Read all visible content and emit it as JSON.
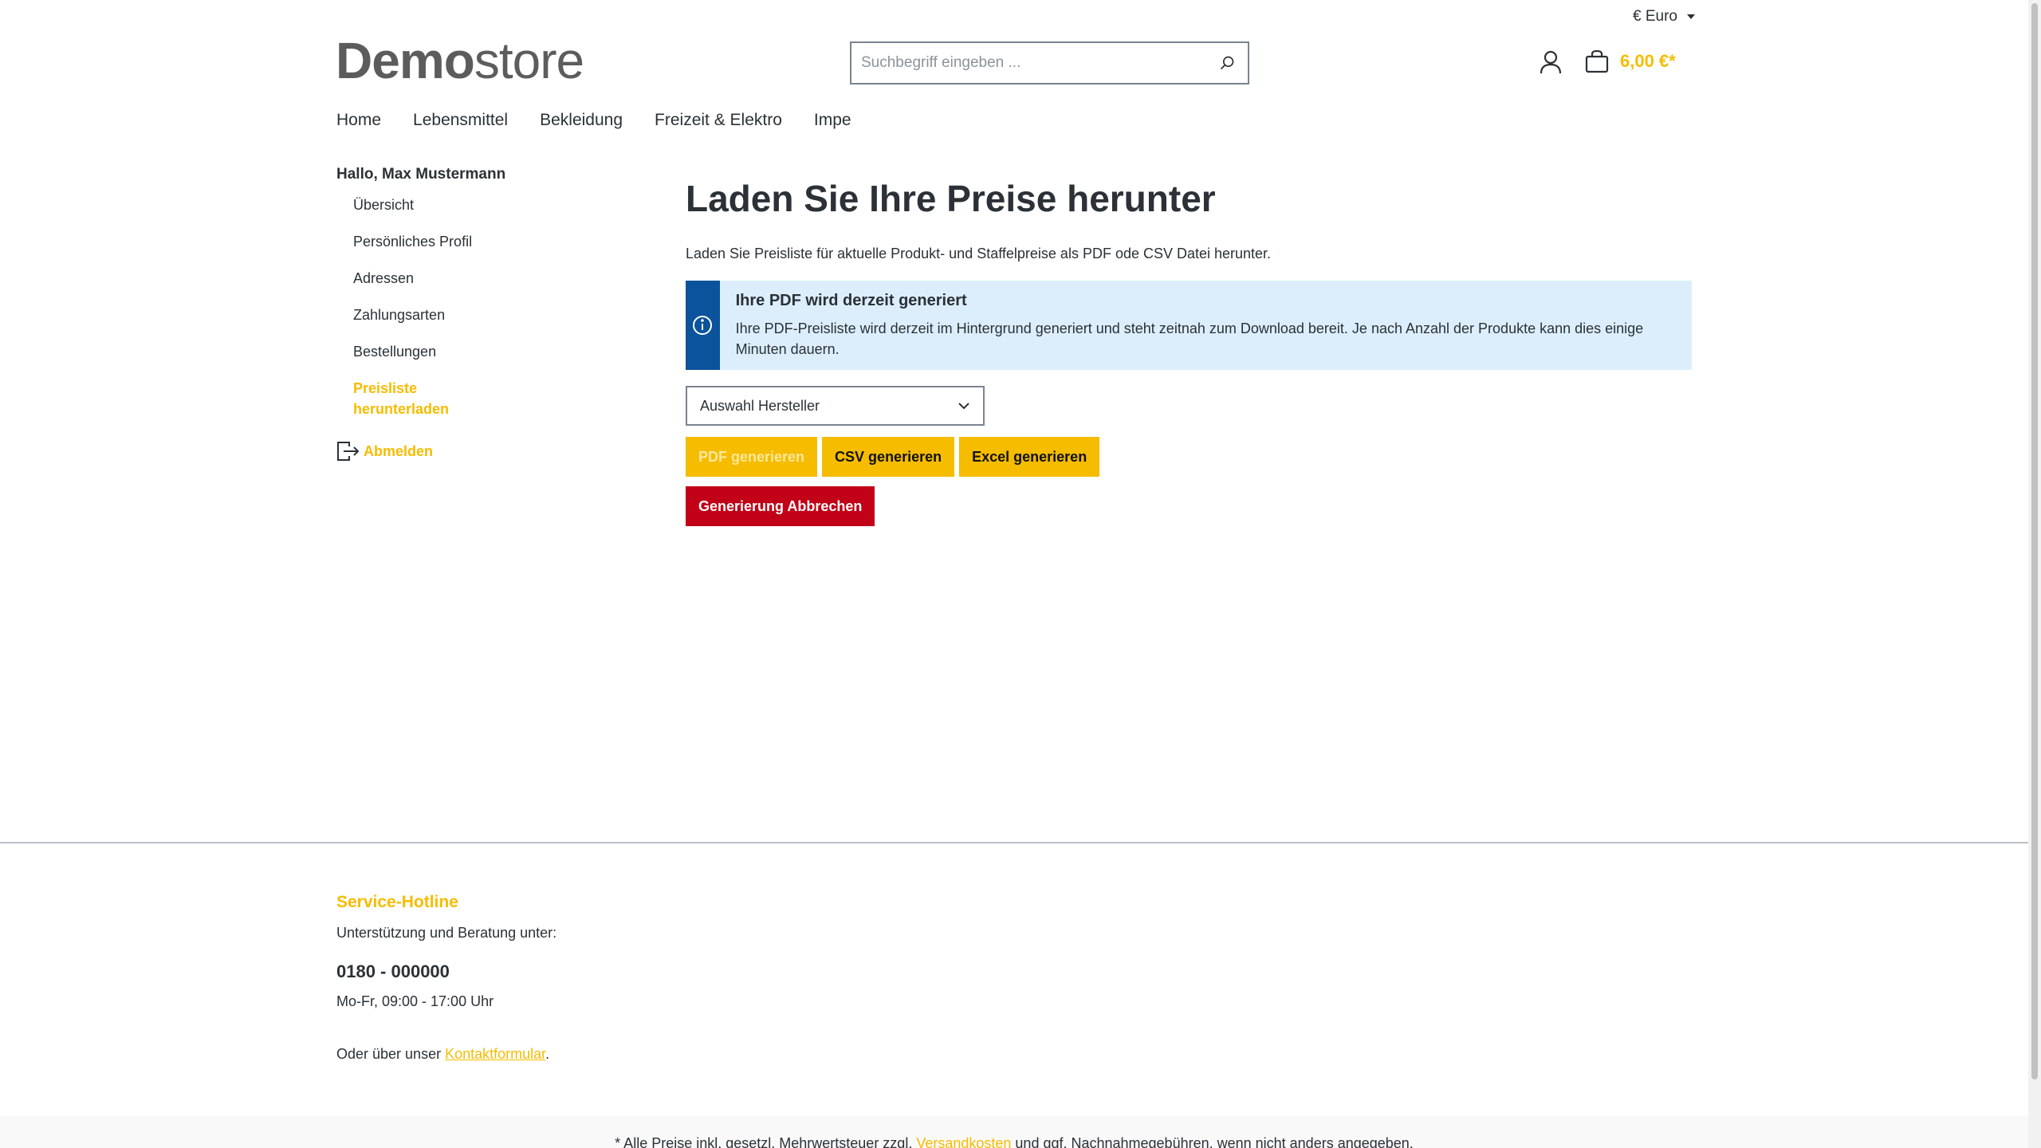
{
  "header": {
    "currency": "€ Euro",
    "logo_bold": "Demo",
    "logo_light": "store",
    "search_placeholder": "Suchbegriff eingeben ...",
    "cart_total": "6,00 €*"
  },
  "nav": {
    "items": [
      "Home",
      "Lebensmittel",
      "Bekleidung",
      "Freizeit & Elektro",
      "Impe"
    ]
  },
  "sidebar": {
    "greeting": "Hallo, Max Mustermann",
    "items": [
      "Übersicht",
      "Persönliches Profil",
      "Adressen",
      "Zahlungsarten",
      "Bestellungen"
    ],
    "active_line1": "Preisliste",
    "active_line2": "herunterladen",
    "logout": "Abmelden"
  },
  "main": {
    "title": "Laden Sie Ihre Preise herunter",
    "description": "Laden Sie Preisliste für aktuelle Produkt- und Staffelpreise als PDF ode CSV Datei herunter.",
    "info_title": "Ihre PDF wird derzeit generiert",
    "info_text": "Ihre PDF-Preisliste wird derzeit im Hintergrund generiert und steht zeitnah zum Download bereit. Je nach Anzahl der Produkte kann dies einige Minuten dauern.",
    "select_value": "Auswahl Hersteller",
    "btn_pdf": "PDF generieren",
    "btn_csv": "CSV generieren",
    "btn_excel": "Excel generieren",
    "btn_cancel": "Generierung Abbrechen"
  },
  "footer": {
    "title": "Service-Hotline",
    "support_text": "Unterstützung und Beratung unter:",
    "phone": "0180 - 000000",
    "hours": "Mo-Fr, 09:00 - 17:00 Uhr",
    "contact_prefix": "Oder über unser ",
    "contact_link": "Kontaktformular",
    "contact_suffix": ".",
    "bottom_prefix": "* Alle Preise inkl. gesetzl. Mehrwertsteuer zzgl. ",
    "bottom_link": "Versandkosten",
    "bottom_suffix": " und ggf. Nachnahmegebühren, wenn nicht anders angegeben."
  },
  "colors": {
    "accent": "#f6bc00",
    "info_bg": "#dceefc",
    "info_stripe": "#0b539b",
    "danger": "#c20017"
  }
}
